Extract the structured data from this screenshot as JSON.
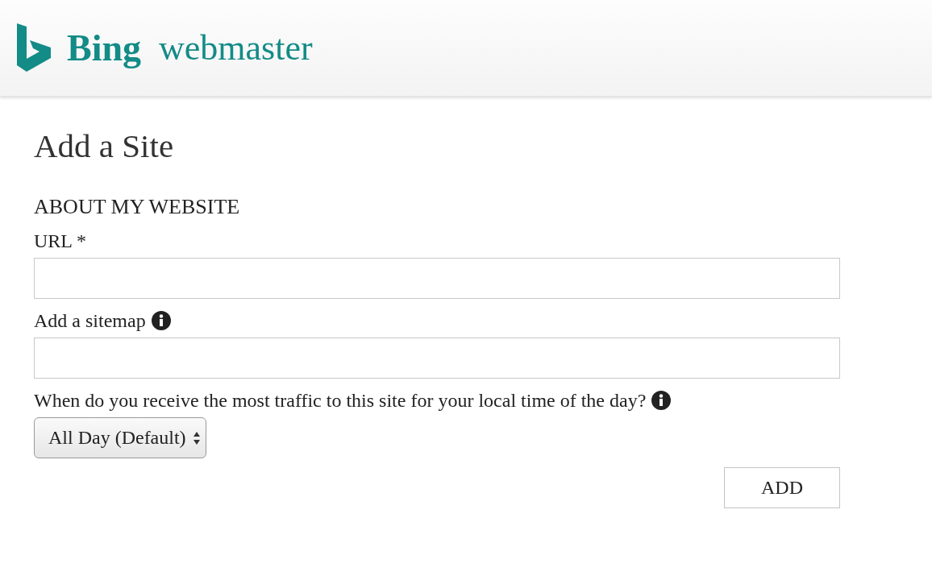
{
  "header": {
    "brand": "Bing",
    "product": "webmaster"
  },
  "page_title": "Add a Site",
  "section_title": "ABOUT MY WEBSITE",
  "fields": [
    {
      "kind": "text",
      "label": "URL *",
      "info": false
    },
    {
      "kind": "text",
      "label": "Add a sitemap",
      "info": true
    },
    {
      "kind": "select",
      "label": "When do you receive the most traffic to this site for your local time of the day?",
      "info": true,
      "value": "All Day (Default)"
    }
  ],
  "buttons": [
    "ADD"
  ]
}
